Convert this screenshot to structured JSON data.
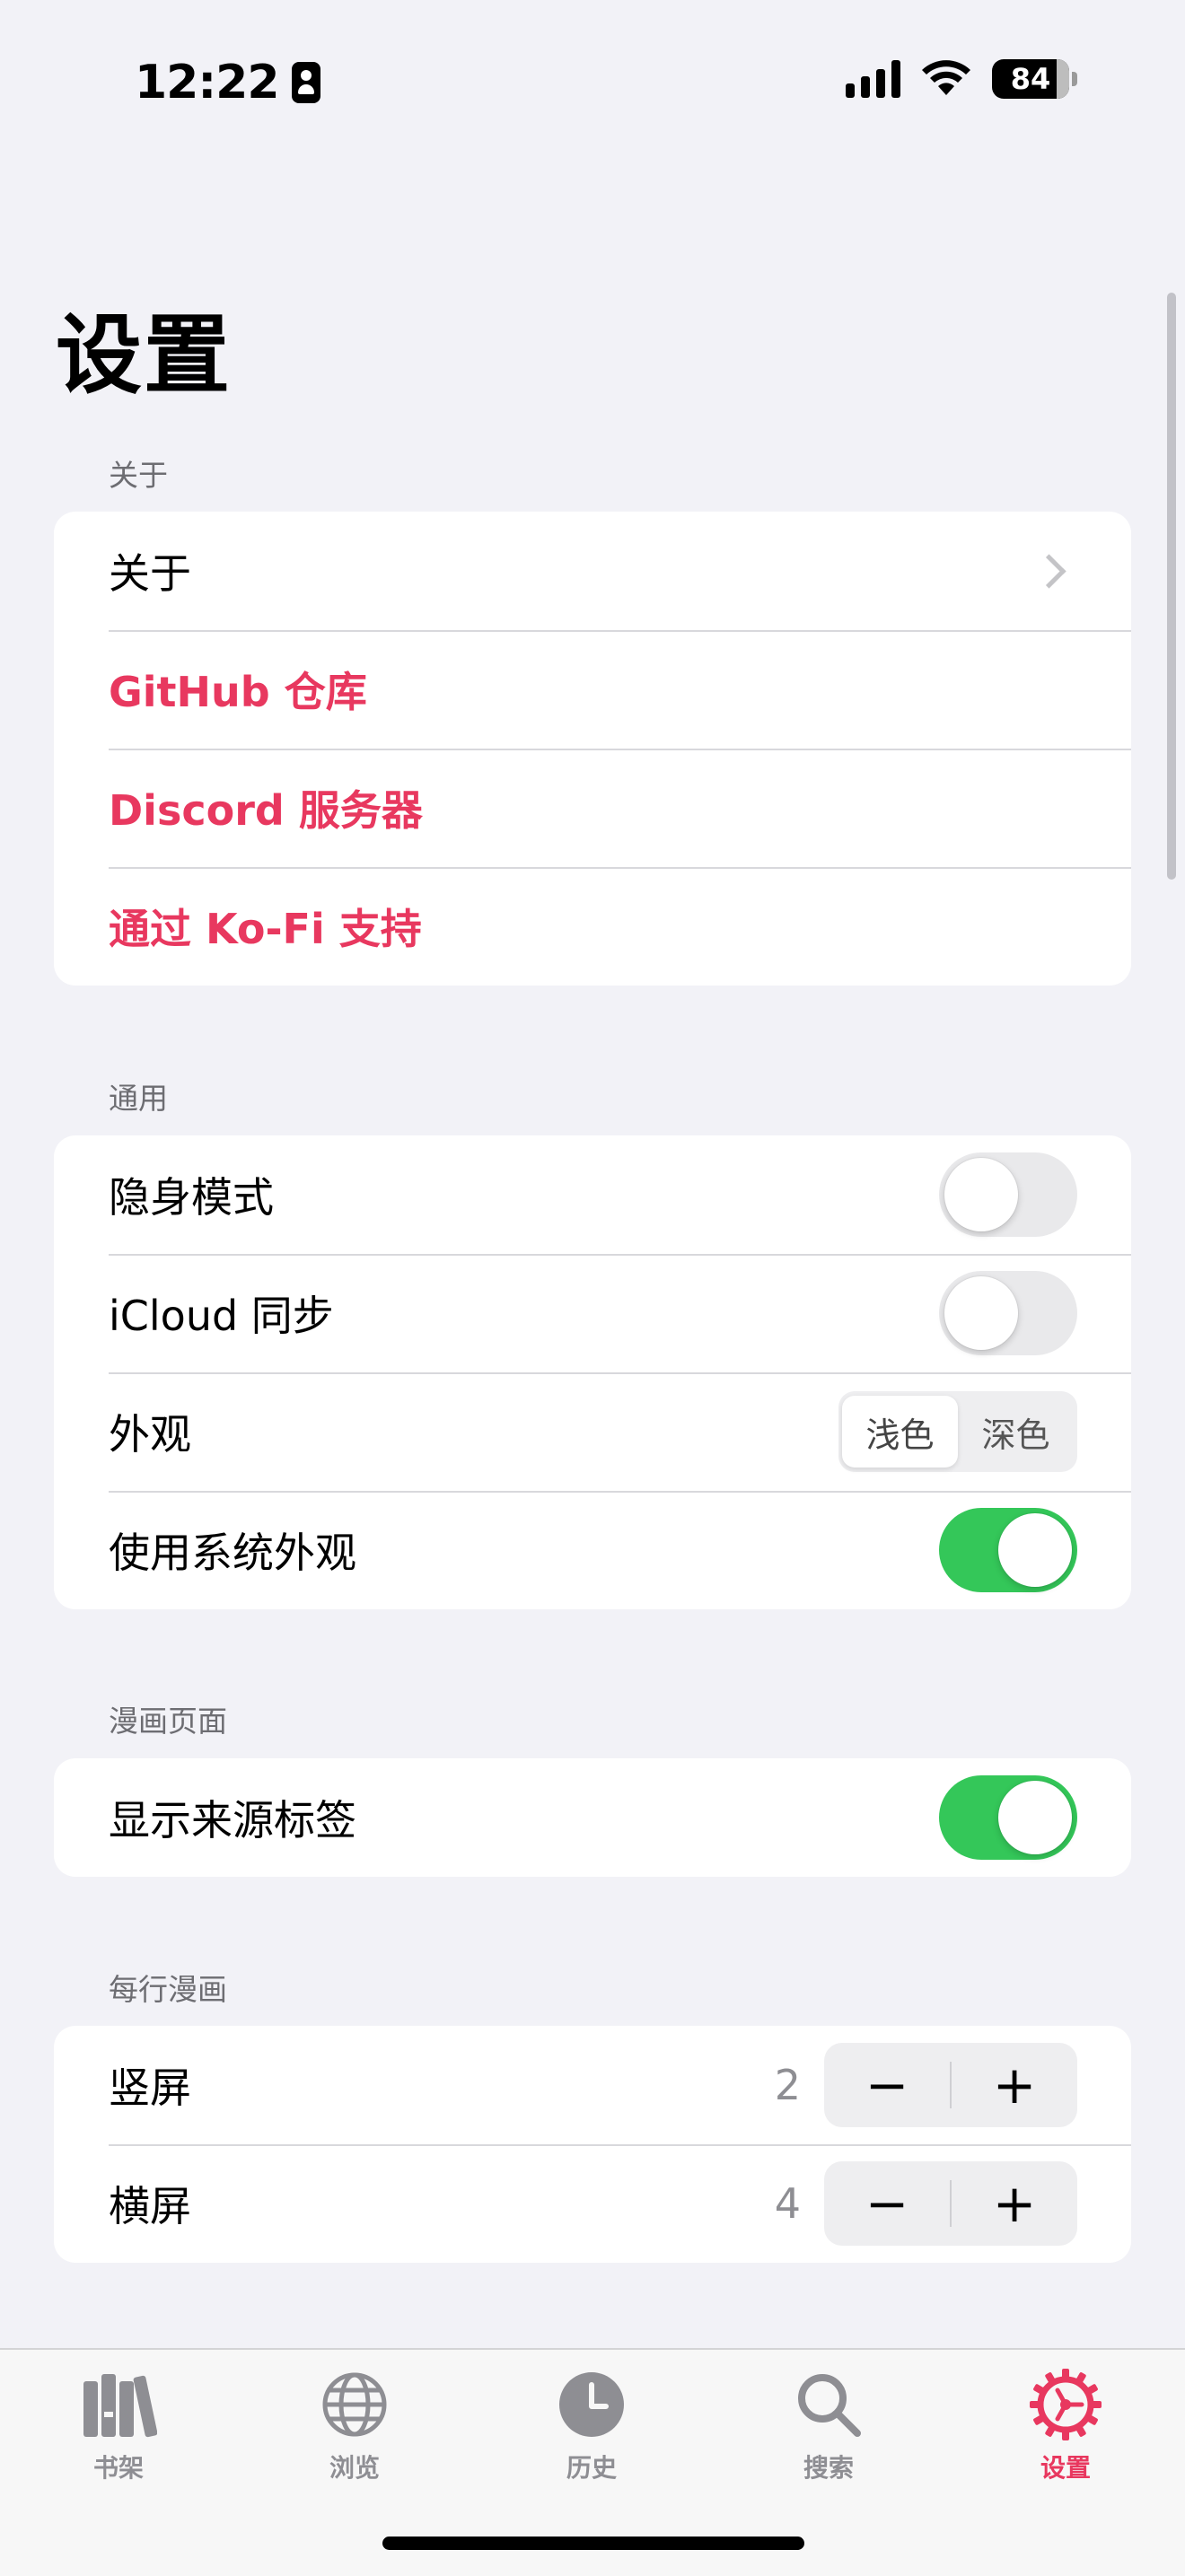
{
  "status_bar": {
    "time": "12:22",
    "battery": "84"
  },
  "page": {
    "title": "设置"
  },
  "sections": {
    "about": {
      "header": "关于",
      "items": [
        {
          "label": "关于"
        },
        {
          "label": "GitHub 仓库"
        },
        {
          "label": "Discord 服务器"
        },
        {
          "label": "通过 Ko-Fi 支持"
        }
      ]
    },
    "general": {
      "header": "通用",
      "incognito": {
        "label": "隐身模式",
        "on": false
      },
      "icloud_sync": {
        "label": "iCloud 同步",
        "on": false
      },
      "appearance": {
        "label": "外观",
        "options": [
          "浅色",
          "深色"
        ],
        "selected": "浅色"
      },
      "system_appearance": {
        "label": "使用系统外观",
        "on": true
      }
    },
    "manga_page": {
      "header": "漫画页面",
      "show_source_label": {
        "label": "显示来源标签",
        "on": true
      }
    },
    "per_row": {
      "header": "每行漫画",
      "portrait": {
        "label": "竖屏",
        "value": "2"
      },
      "landscape": {
        "label": "横屏",
        "value": "4"
      },
      "minus": "−",
      "plus": "+"
    }
  },
  "tab_bar": {
    "tabs": [
      {
        "label": "书架",
        "icon": "library-icon"
      },
      {
        "label": "浏览",
        "icon": "globe-icon"
      },
      {
        "label": "历史",
        "icon": "clock-icon"
      },
      {
        "label": "搜索",
        "icon": "search-icon"
      },
      {
        "label": "设置",
        "icon": "gear-icon"
      }
    ],
    "active": "设置"
  },
  "colors": {
    "accent": "#e8385f",
    "toggle_on": "#34c759",
    "background": "#f2f2f7"
  }
}
